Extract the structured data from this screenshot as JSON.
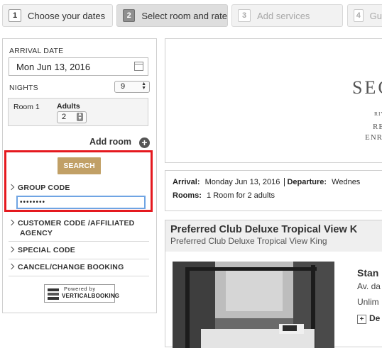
{
  "steps": [
    {
      "num": "1",
      "label": "Choose your dates"
    },
    {
      "num": "2",
      "label": "Select room and rate"
    },
    {
      "num": "3",
      "label": "Add services"
    },
    {
      "num": "4",
      "label": "Gu"
    }
  ],
  "form": {
    "arrival_label": "ARRIVAL DATE",
    "arrival_value": "Mon Jun 13, 2016",
    "nights_label": "NIGHTS",
    "nights_value": "9",
    "room_label": "Room 1",
    "adults_label": "Adults",
    "adults_value": "2",
    "add_room_label": "Add room",
    "search_label": "SEARCH",
    "group_code_label": "GROUP CODE",
    "group_code_value": "••••••••",
    "customer_code_label_1": "CUSTOMER CODE /AFFILIATED",
    "customer_code_label_2": "AGENCY",
    "special_code_label": "SPECIAL CODE",
    "cancel_label": "CANCEL/CHANGE BOOKING",
    "powered_line1": "Powered by",
    "powered_line2": "VERTICALBOOKING"
  },
  "hotel": {
    "logo_text": "SEC",
    "line1": "RIV",
    "line2": "RE",
    "line3": "ENR"
  },
  "booking_info": {
    "arrival_label": "Arrival:",
    "arrival_value": "Monday Jun 13, 2016",
    "departure_label": "Departure:",
    "departure_value": "Wednes",
    "rooms_label": "Rooms:",
    "rooms_value": "1 Room for 2 adults"
  },
  "room": {
    "title": "Preferred Club Deluxe Tropical View K",
    "subtitle": "Preferred Club Deluxe Tropical View King",
    "rate_title": "Stan",
    "rate_line2": "Av. da",
    "rate_line3": "Unlim",
    "details_label": "De"
  },
  "colors": {
    "accent_gold": "#c1a066",
    "highlight_red": "#e5191f",
    "focus_blue": "#6fa4e3"
  }
}
